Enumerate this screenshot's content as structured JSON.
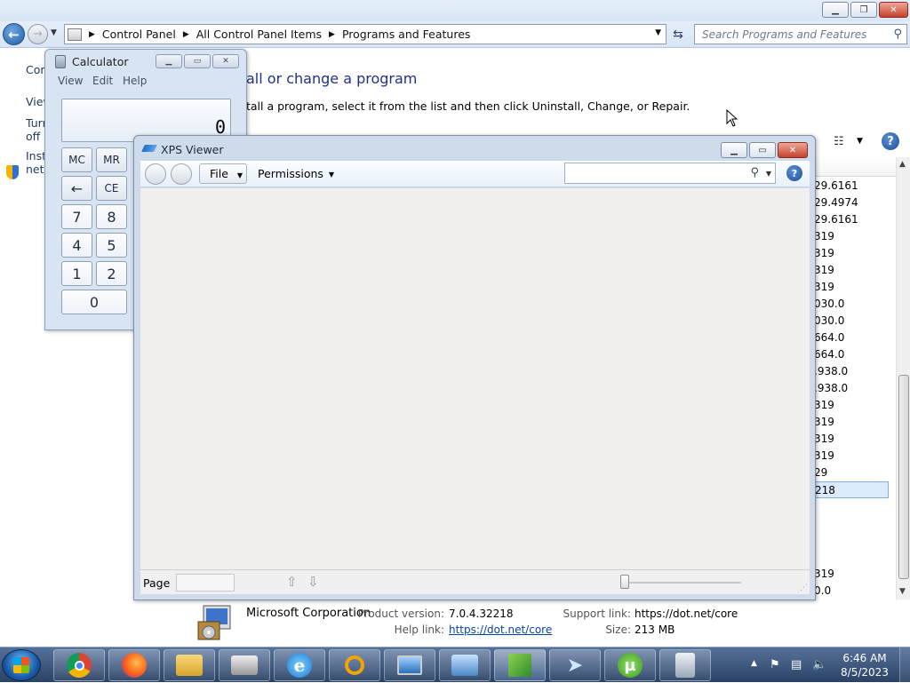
{
  "explorer": {
    "breadcrumbs": [
      "Control Panel",
      "All Control Panel Items",
      "Programs and Features"
    ],
    "search_placeholder": "Search Programs and Features",
    "left_links": [
      "Con",
      "View",
      "Turn",
      "off",
      "Insta",
      "netw"
    ],
    "title": "all or change a program",
    "description": "tall a program, select it from the list and then click Uninstall, Change, or Repair.",
    "versions": [
      "29.6161",
      "29.4974",
      "29.6161",
      "319",
      "319",
      "319",
      "319",
      "030.0",
      "030.0",
      "664.0",
      "664.0",
      ".938.0",
      ".938.0",
      "319",
      "319",
      "319",
      "319",
      "29",
      "218",
      "",
      "",
      "",
      "319",
      "0.0"
    ],
    "selected_version_index": 18,
    "details": {
      "publisher": "Microsoft Corporation",
      "product_version_label": "Product version:",
      "product_version": "7.0.4.32218",
      "help_link_label": "Help link:",
      "help_link": "https://dot.net/core",
      "support_link_label": "Support link:",
      "support_link": "https://dot.net/core",
      "size_label": "Size:",
      "size": "213 MB"
    }
  },
  "calculator": {
    "title": "Calculator",
    "menu": [
      "View",
      "Edit",
      "Help"
    ],
    "display": "0",
    "keys": [
      "MC",
      "MR",
      "←",
      "CE",
      "7",
      "8",
      "4",
      "5",
      "1",
      "2",
      "0"
    ]
  },
  "xps": {
    "title": "XPS Viewer",
    "file_menu": "File",
    "permissions_menu": "Permissions",
    "page_label": "Page",
    "zoom_level": 0
  },
  "taskbar": {
    "time": "6:46 AM",
    "date": "8/5/2023",
    "apps": [
      "chrome-icon",
      "firefox-icon",
      "file-explorer-icon",
      "printer-icon",
      "internet-explorer-icon",
      "search-magnifier-icon",
      "remote-desktop-icon",
      "control-panel-icon",
      "paint-icon",
      "telegram-icon",
      "utorrent-icon",
      "calculator-icon"
    ],
    "active_app_index": 8
  },
  "colors": {
    "accent": "#1e3287",
    "taskbar": "#3a5479",
    "selection": "#dcebfc"
  }
}
